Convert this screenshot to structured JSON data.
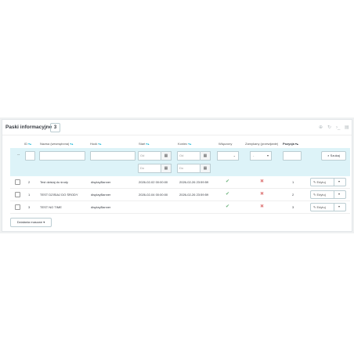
{
  "panel": {
    "title": "Paski informacyjne",
    "count": "3",
    "icons": [
      "add-icon",
      "refresh-icon",
      "sql-icon",
      "export-icon"
    ]
  },
  "columns": {
    "id": "ID",
    "name": "Nazwa (wewnętrzna)",
    "hook": "Hook",
    "start": "Start",
    "end": "Koniec",
    "enabled": "Włączony",
    "closeable": "Zamykany (przewijanie)",
    "position": "Pozycja"
  },
  "filters": {
    "date_from": "Od",
    "date_to": "Do",
    "closeable_value": "-",
    "dash": "--",
    "search": "Szukaj"
  },
  "rows": [
    {
      "id": "2",
      "name": "Test dzisiaj do środy",
      "hook": "displayBanner",
      "start": "2026-02-02 00:00:00",
      "end": "2026-02-26 23:59:59",
      "enabled": true,
      "closeable": false,
      "position": "1"
    },
    {
      "id": "1",
      "name": "TEST DZISIAJ DO ŚRODY",
      "hook": "displayBanner",
      "start": "2026-02-04 00:00:00",
      "end": "2026-02-26 23:59:59",
      "enabled": true,
      "closeable": false,
      "position": "2"
    },
    {
      "id": "3",
      "name": "TEST NO TIME",
      "hook": "displayBanner",
      "start": "",
      "end": "",
      "enabled": true,
      "closeable": false,
      "position": "3"
    }
  ],
  "row_actions": {
    "edit": "Edytuj"
  },
  "bulk": {
    "label": "Działania masowe"
  },
  "colors": {
    "accent": "#25b9d7",
    "check": "#70b580",
    "cross": "#e08080",
    "filter_bg": "#ddf3f8"
  }
}
